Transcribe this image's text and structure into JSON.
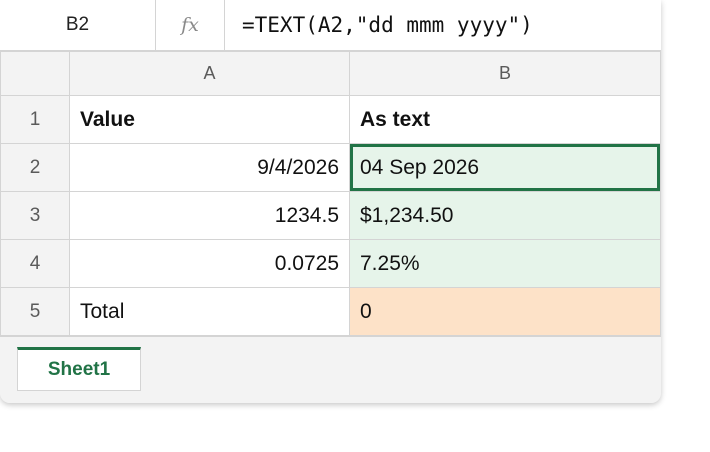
{
  "formula_bar": {
    "name_box": "B2",
    "fx_label": "fx",
    "formula": "=TEXT(A2,\"dd mmm yyyy\")"
  },
  "columns": [
    "A",
    "B"
  ],
  "rows": [
    {
      "row": "1",
      "a": "Value",
      "b": "As text"
    },
    {
      "row": "2",
      "a": "9/4/2026",
      "b": "04 Sep 2026"
    },
    {
      "row": "3",
      "a": "1234.5",
      "b": "$1,234.50"
    },
    {
      "row": "4",
      "a": "0.0725",
      "b": "7.25%"
    },
    {
      "row": "5",
      "a": "Total",
      "b": "0"
    }
  ],
  "selected_cell": "B2",
  "colors": {
    "accent": "#217346",
    "result_fill": "#e6f4ea",
    "total_fill": "#fde2c8"
  },
  "sheet_tabs": [
    "Sheet1"
  ]
}
